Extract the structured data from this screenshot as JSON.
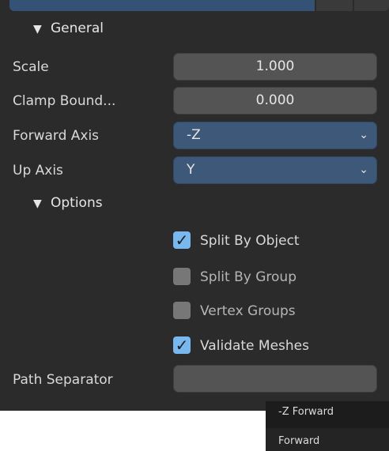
{
  "sections": {
    "general": "General",
    "options": "Options"
  },
  "fields": {
    "scale": {
      "label": "Scale",
      "value": "1.000"
    },
    "clamp": {
      "label": "Clamp Bound...",
      "value": "0.000"
    },
    "forward_axis": {
      "label": "Forward Axis",
      "value": "-Z"
    },
    "up_axis": {
      "label": "Up Axis",
      "value": "Y"
    },
    "path_separator": {
      "label": "Path Separator",
      "value": ""
    }
  },
  "options": [
    {
      "label": "Split By Object",
      "checked": true
    },
    {
      "label": "Split By Group",
      "checked": false
    },
    {
      "label": "Vertex Groups",
      "checked": false
    },
    {
      "label": "Validate Meshes",
      "checked": true
    }
  ],
  "popup": {
    "item1": "-Z Forward",
    "item2": "Forward"
  },
  "icons": {
    "expand": "triangle-down-icon",
    "dropdown": "chevron-down-icon",
    "check": "checkmark-icon"
  },
  "colors": {
    "panel_bg": "#2b2b2b",
    "field_bg": "#545454",
    "select_bg": "#3d5878",
    "checkbox_on": "#79b8ee",
    "checkbox_off": "#777777"
  }
}
